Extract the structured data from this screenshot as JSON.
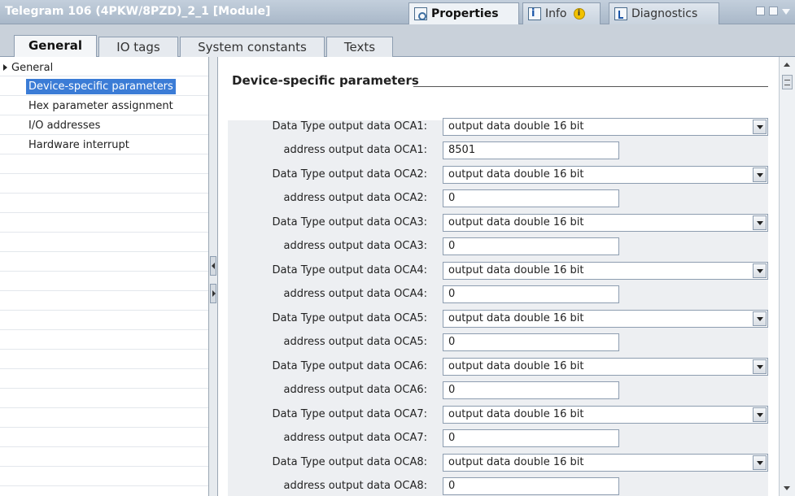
{
  "window": {
    "title": "Telegram 106 (4PKW/8PZD)_2_1 [Module]",
    "inspector_tabs": [
      {
        "label": "Properties",
        "icon": "properties-icon",
        "active": true
      },
      {
        "label": "Info",
        "icon": "info-icon",
        "badge_icon": "info-badge-icon",
        "badge_text": "i"
      },
      {
        "label": "Diagnostics",
        "icon": "diagnostics-icon"
      }
    ]
  },
  "tabs": [
    "General",
    "IO tags",
    "System constants",
    "Texts"
  ],
  "nav": {
    "items": [
      {
        "label": "General",
        "expandable": true
      },
      {
        "label": "Device-specific parameters",
        "selected": true
      },
      {
        "label": "Hex parameter assignment"
      },
      {
        "label": "I/O addresses"
      },
      {
        "label": "Hardware interrupt"
      }
    ]
  },
  "section": {
    "title": "Device-specific parameters"
  },
  "params": [
    {
      "type_label": "Data Type output data OCA1:",
      "type_value": "output data double 16 bit",
      "addr_label": "address output data OCA1:",
      "addr_value": "8501"
    },
    {
      "type_label": "Data Type output data OCA2:",
      "type_value": "output data double 16 bit",
      "addr_label": "address output data OCA2:",
      "addr_value": "0"
    },
    {
      "type_label": "Data Type output data OCA3:",
      "type_value": "output data double 16 bit",
      "addr_label": "address output data OCA3:",
      "addr_value": "0"
    },
    {
      "type_label": "Data Type output data OCA4:",
      "type_value": "output data double 16 bit",
      "addr_label": "address output data OCA4:",
      "addr_value": "0"
    },
    {
      "type_label": "Data Type output data OCA5:",
      "type_value": "output data double 16 bit",
      "addr_label": "address output data OCA5:",
      "addr_value": "0"
    },
    {
      "type_label": "Data Type output data OCA6:",
      "type_value": "output data double 16 bit",
      "addr_label": "address output data OCA6:",
      "addr_value": "0"
    },
    {
      "type_label": "Data Type output data OCA7:",
      "type_value": "output data double 16 bit",
      "addr_label": "address output data OCA7:",
      "addr_value": "0"
    },
    {
      "type_label": "Data Type output data OCA8:",
      "type_value": "output data double 16 bit",
      "addr_label": "address output data OCA8:",
      "addr_value": "0"
    }
  ]
}
